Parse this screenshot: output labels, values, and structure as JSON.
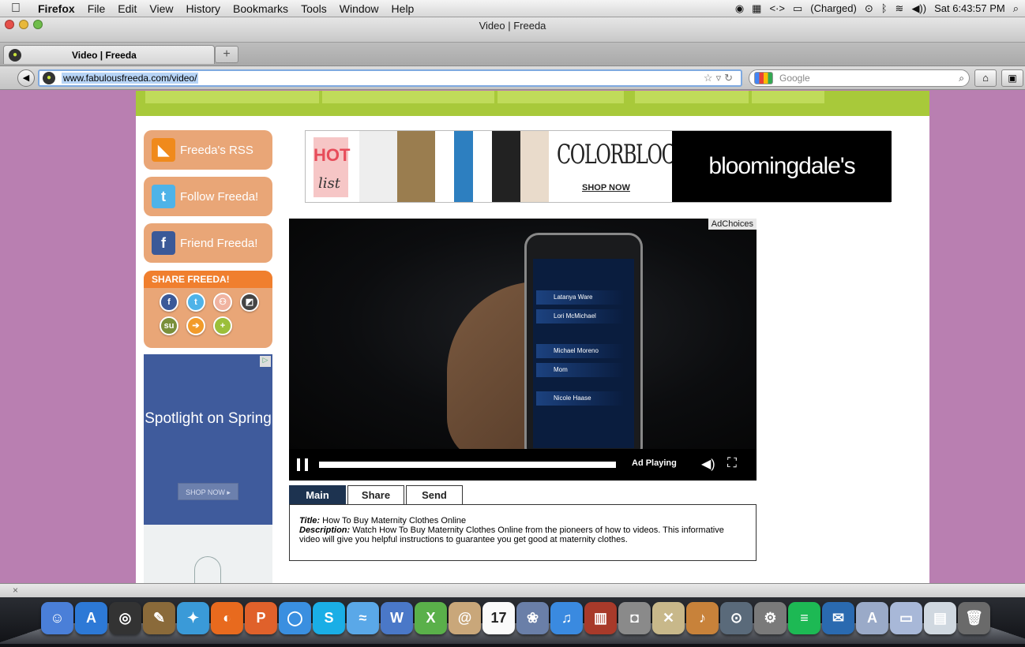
{
  "menubar": {
    "app": "Firefox",
    "items": [
      "File",
      "Edit",
      "View",
      "History",
      "Bookmarks",
      "Tools",
      "Window",
      "Help"
    ],
    "battery": "(Charged)",
    "clock": "Sat 6:43:57 PM"
  },
  "window": {
    "title": "Video | Freeda"
  },
  "tab": {
    "title": "Video | Freeda",
    "new_tab": "+"
  },
  "navbar": {
    "url": "www.fabulousfreeda.com/video/",
    "search_placeholder": "Google"
  },
  "sidebar": {
    "rss": "Freeda's RSS",
    "twitter": "Follow Freeda!",
    "facebook": "Friend Freeda!",
    "share_heading": "SHARE FREEDA!",
    "side_ad_headline": "Spotlight on Spring",
    "side_ad_button": "SHOP NOW ▸"
  },
  "top_ad": {
    "hot": "HOT",
    "list": "list",
    "colorblock": "COLORBLOCK",
    "shop_now": "SHOP NOW",
    "brand": "bloomingdale's"
  },
  "player": {
    "adchoices": "AdChoices",
    "status": "Ad Playing",
    "contacts": [
      "Latanya Ware",
      "Lori McMichael",
      "Michael Moreno",
      "Mom",
      "Nicole Haase"
    ],
    "progress": 0
  },
  "video_tabs": [
    "Main",
    "Share",
    "Send"
  ],
  "video_info": {
    "title_label": "Title:",
    "title": "How To Buy Maternity Clothes Online",
    "description_label": "Description:",
    "description": "Watch How To Buy Maternity Clothes Online from the pioneers of how to videos. This informative video will give you helpful instructions to guarantee you get good at maternity clothes."
  },
  "download_bar": {
    "close": "×"
  },
  "colors": {
    "page_bg": "#b97fb1",
    "nav_green": "#a8c93a",
    "social_button": "#e9a677",
    "share_header": "#f07f2e",
    "active_tab": "#1d3350"
  }
}
